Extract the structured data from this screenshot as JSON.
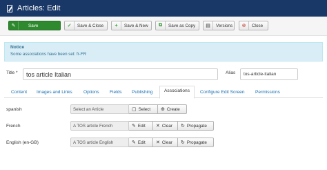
{
  "header": {
    "title": "Articles: Edit"
  },
  "toolbar": {
    "save": "Save",
    "save_close": "Save & Close",
    "save_new": "Save & New",
    "save_copy": "Save as Copy",
    "versions": "Versions",
    "close": "Close"
  },
  "notice": {
    "title": "Notice",
    "text": "Some associations have been set: fr-FR"
  },
  "form": {
    "title_label": "Title *",
    "title_value": "tos article Italian",
    "alias_label": "Alias",
    "alias_value": "tos-article-italian"
  },
  "tabs": [
    "Content",
    "Images and Links",
    "Options",
    "Fields",
    "Publishing",
    "Associations",
    "Configure Edit Screen",
    "Permissions"
  ],
  "active_tab": "Associations",
  "associations": [
    {
      "language": "spanish",
      "value": "Select an Article",
      "buttons": [
        "Select",
        "Create"
      ]
    },
    {
      "language": "French",
      "value": "A TOS article French",
      "buttons": [
        "Edit",
        "Clear",
        "Propagate"
      ]
    },
    {
      "language": "English (en-GB)",
      "value": "A TOS article English",
      "buttons": [
        "Edit",
        "Clear",
        "Propagate"
      ]
    }
  ],
  "colors": {
    "header_bg": "#1a3867",
    "save_bg": "#2f8a2f",
    "notice_bg": "#d9edf7",
    "link": "#1a6fb0"
  }
}
